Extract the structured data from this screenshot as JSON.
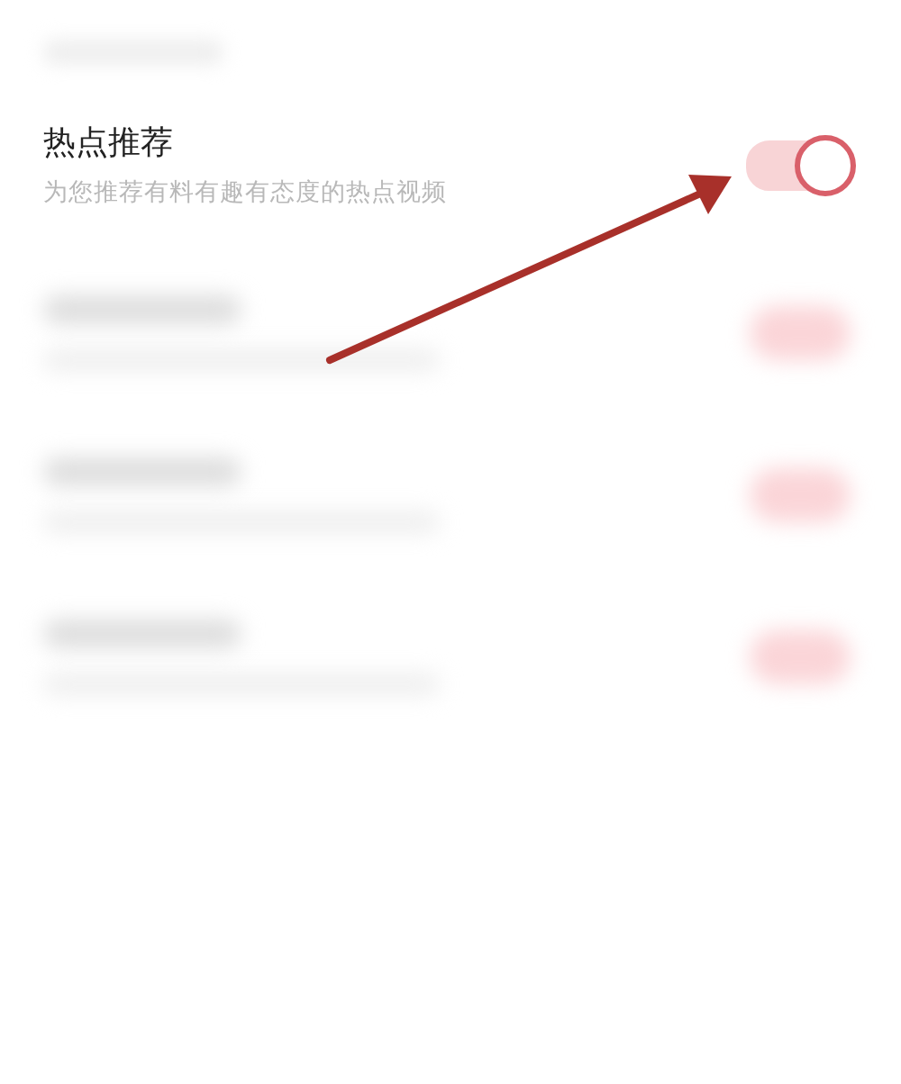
{
  "setting": {
    "title": "热点推荐",
    "description": "为您推荐有料有趣有态度的热点视频",
    "on": true
  },
  "blurred_rows": [
    {
      "on": true
    },
    {
      "on": true
    },
    {
      "on": true
    }
  ],
  "annotation": {
    "kind": "arrow"
  }
}
